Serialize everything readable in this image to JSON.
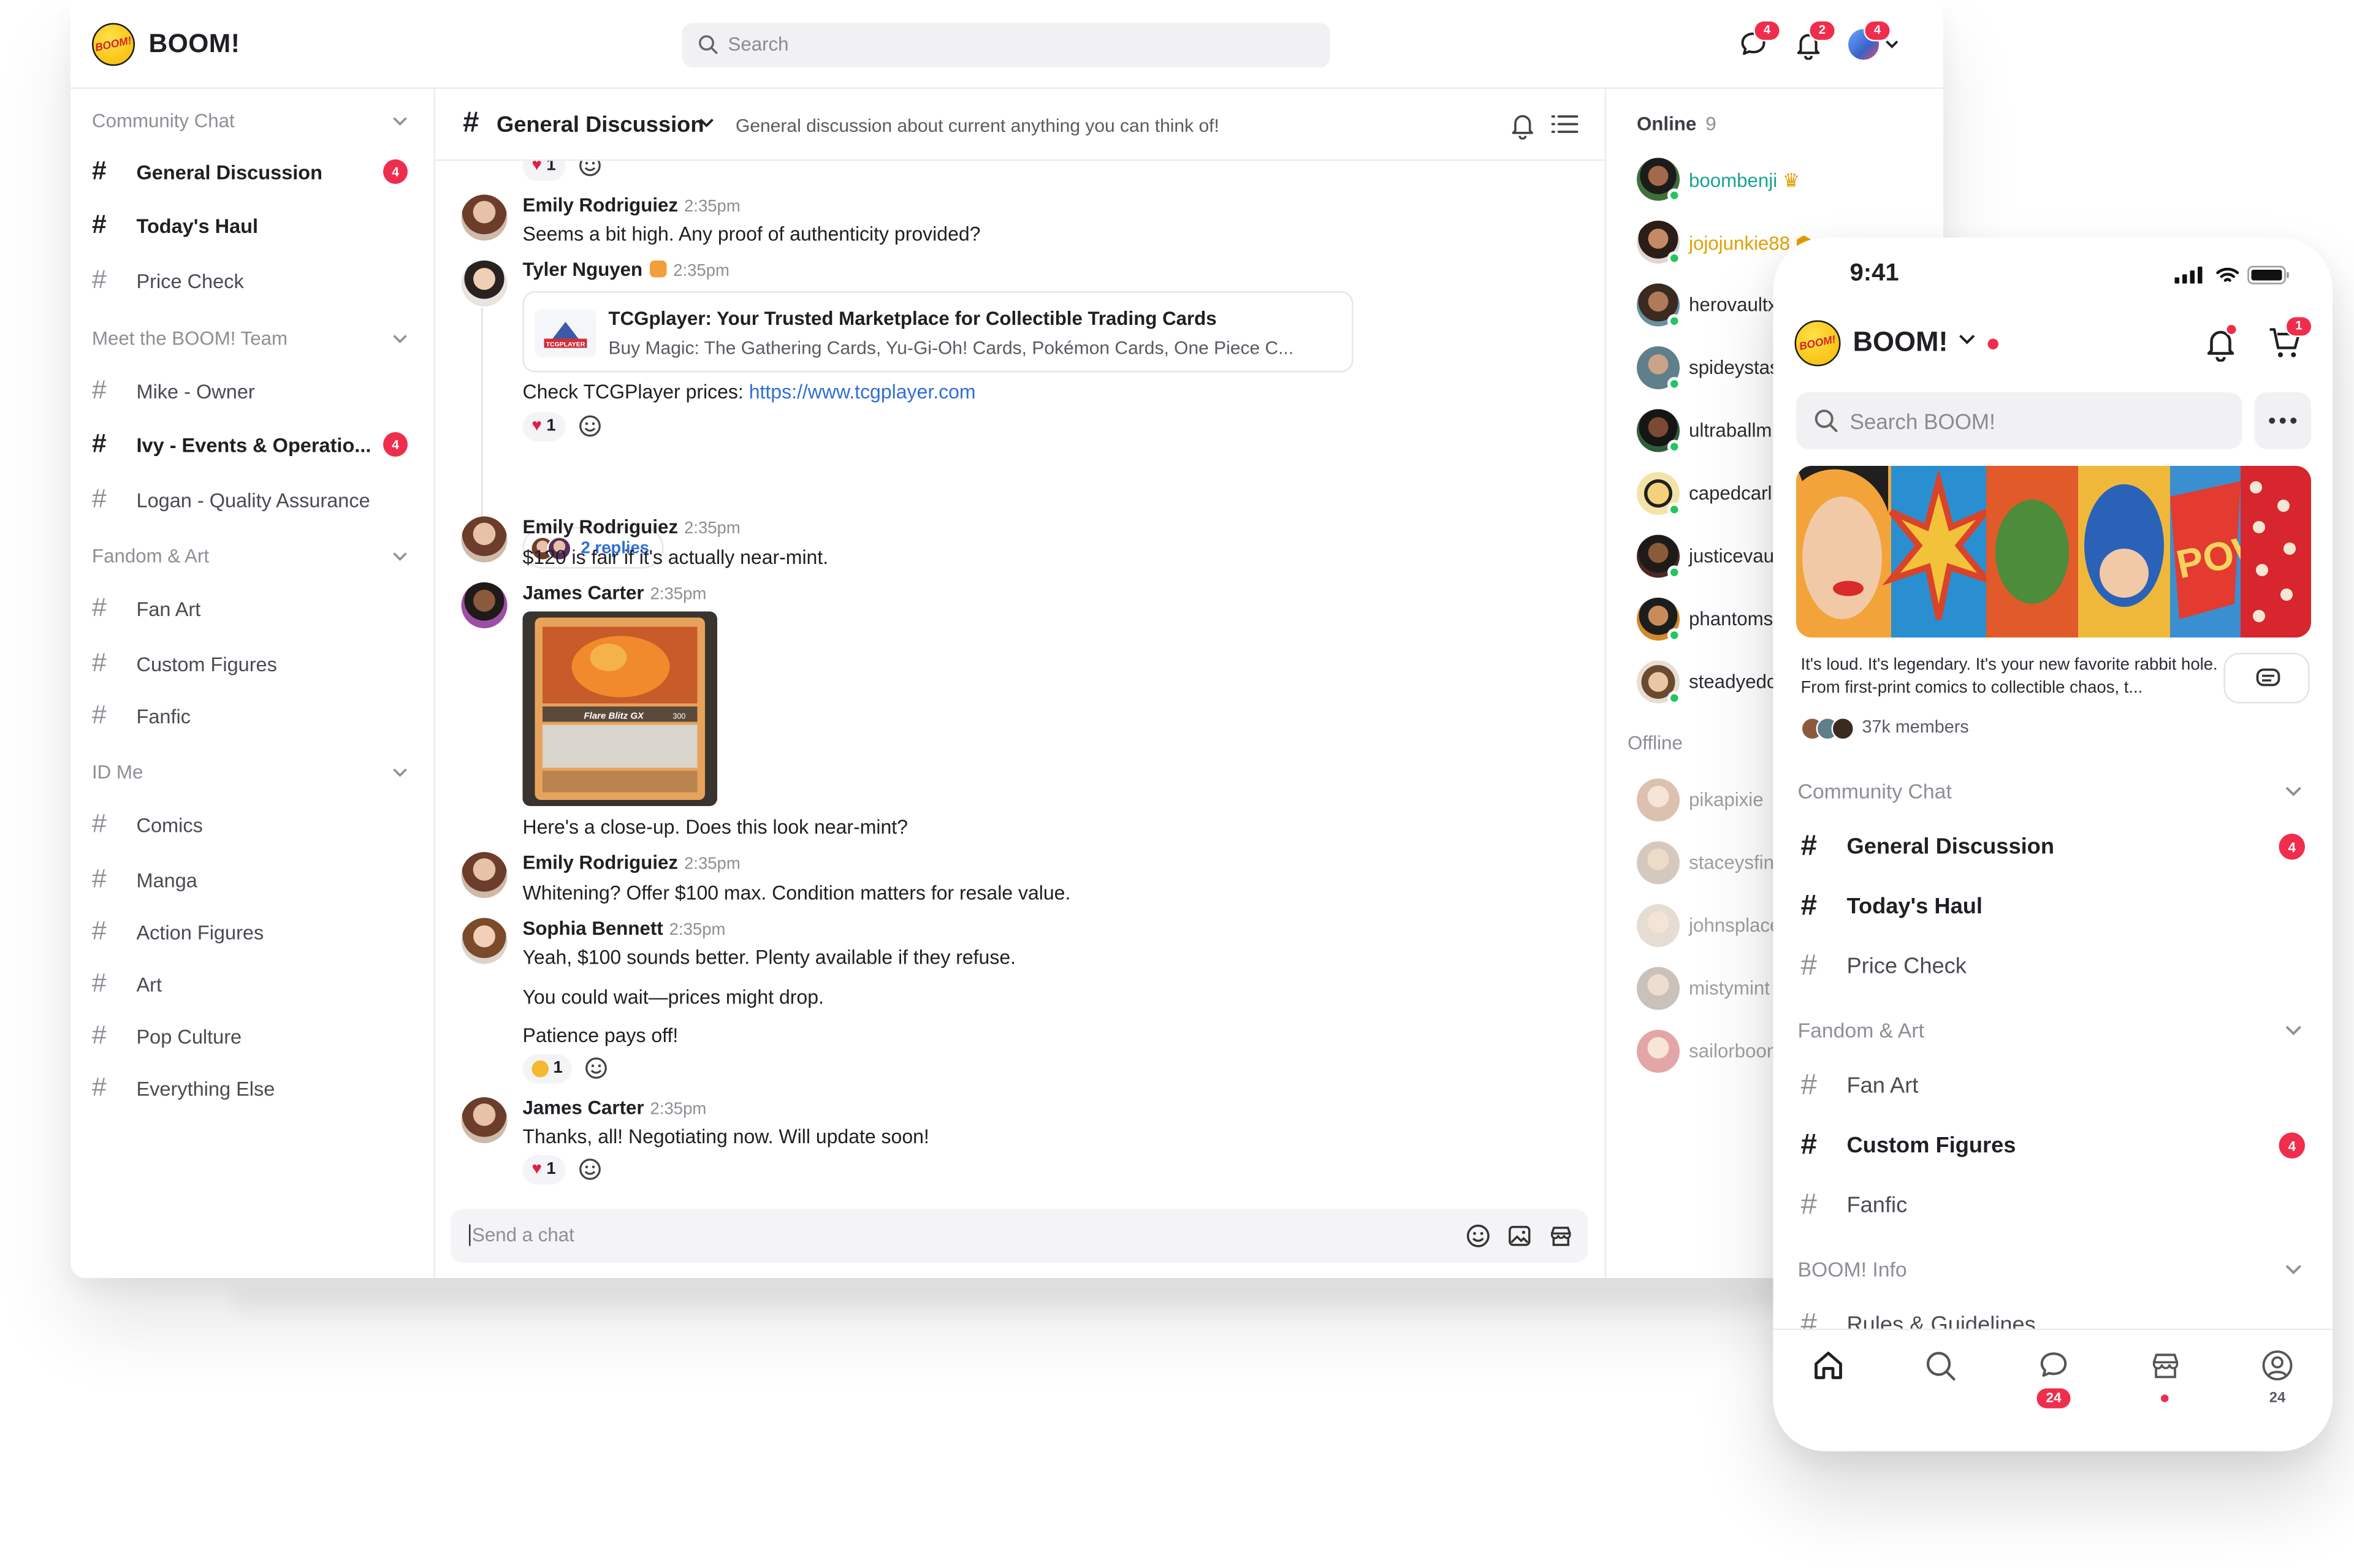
{
  "app": {
    "brand": "BOOM!",
    "logo_text": "BOOM!"
  },
  "topbar": {
    "search_placeholder": "Search",
    "chat_badge": "4",
    "notif_badge": "2",
    "avatar_badge": "4"
  },
  "sidebar": {
    "sections": [
      {
        "title": "Community Chat",
        "channels": [
          {
            "label": "General Discussion",
            "bold": true,
            "count": "4"
          },
          {
            "label": "Today's Haul",
            "bold": true,
            "count": ""
          },
          {
            "label": "Price Check",
            "bold": false,
            "count": ""
          }
        ]
      },
      {
        "title": "Meet the BOOM! Team",
        "channels": [
          {
            "label": "Mike - Owner",
            "bold": false,
            "count": ""
          },
          {
            "label": "Ivy - Events & Operatio...",
            "bold": true,
            "count": "4"
          },
          {
            "label": "Logan - Quality Assurance",
            "bold": false,
            "count": ""
          }
        ]
      },
      {
        "title": "Fandom & Art",
        "channels": [
          {
            "label": "Fan Art",
            "bold": false,
            "count": ""
          },
          {
            "label": "Custom Figures",
            "bold": false,
            "count": ""
          },
          {
            "label": "Fanfic",
            "bold": false,
            "count": ""
          }
        ]
      },
      {
        "title": "ID Me",
        "channels": [
          {
            "label": "Comics",
            "bold": false,
            "count": ""
          },
          {
            "label": "Manga",
            "bold": false,
            "count": ""
          },
          {
            "label": "Action Figures",
            "bold": false,
            "count": ""
          },
          {
            "label": "Art",
            "bold": false,
            "count": ""
          },
          {
            "label": "Pop Culture",
            "bold": false,
            "count": ""
          },
          {
            "label": "Everything Else",
            "bold": false,
            "count": ""
          }
        ]
      }
    ]
  },
  "chat": {
    "channel_title": "General Discussion",
    "channel_desc": "General discussion about current anything you can think of!",
    "top_reaction": "1",
    "messages": [
      {
        "name": "Emily Rodriguiez",
        "time": "2:35pm",
        "text": "Seems a bit high. Any proof of authenticity provided?"
      },
      {
        "name": "Tyler Nguyen",
        "time": "2:35pm",
        "link_title": "TCGplayer: Your Trusted Marketplace for Collectible Trading Cards",
        "link_desc": "Buy Magic: The Gathering Cards, Yu-Gi-Oh! Cards, Pokémon Cards, One Piece C...",
        "link_thumb": "TCGPLAYER",
        "text": "Check TCGPlayer prices: ",
        "url": "https://www.tcgplayer.com",
        "reaction": "1",
        "replies": "2 replies"
      },
      {
        "name": "Emily Rodriguiez",
        "time": "2:35pm",
        "text": "$120 is fair if it's actually near-mint."
      },
      {
        "name": "James Carter",
        "time": "2:35pm",
        "card_line": "Flare Blitz GX",
        "card_hp": "300",
        "text": "Here's a close-up. Does this look near-mint?"
      },
      {
        "name": "Emily Rodriguiez",
        "time": "2:35pm",
        "text": "Whitening? Offer $100 max. Condition matters for resale value."
      },
      {
        "name": "Sophia Bennett",
        "time": "2:35pm",
        "text": "Yeah, $100 sounds better. Plenty available if they refuse.",
        "text2": "You could wait—prices might drop.",
        "text3": "Patience pays off!",
        "reaction": "1"
      },
      {
        "name": "James Carter",
        "time": "2:35pm",
        "text": "Thanks, all! Negotiating now. Will update soon!",
        "reaction": "1"
      }
    ],
    "composer_placeholder": "Send a chat"
  },
  "members": {
    "online_label": "Online",
    "online_count": "9",
    "offline_label": "Offline",
    "online": [
      {
        "name": "boombenji",
        "color": "#16a394"
      },
      {
        "name": "jojojunkie88",
        "color": "#e0a000"
      },
      {
        "name": "herovaultx",
        "color": "#2b2b33"
      },
      {
        "name": "spideystas",
        "color": "#2b2b33"
      },
      {
        "name": "ultraballmi",
        "color": "#2b2b33"
      },
      {
        "name": "capedcarl",
        "color": "#2b2b33"
      },
      {
        "name": "justicevau",
        "color": "#2b2b33"
      },
      {
        "name": "phantoms",
        "color": "#2b2b33"
      },
      {
        "name": "steadyedc",
        "color": "#2b2b33"
      }
    ],
    "offline": [
      {
        "name": "pikapixie"
      },
      {
        "name": "staceysfin"
      },
      {
        "name": "johnsplace"
      },
      {
        "name": "mistymint"
      },
      {
        "name": "sailorboon"
      }
    ]
  },
  "phone": {
    "time": "9:41",
    "brand": "BOOM!",
    "cart_badge": "1",
    "search_placeholder": "Search BOOM!",
    "banner_word": "POW",
    "desc": "It's loud. It's legendary. It's your new favorite rabbit hole. From first-print comics to collectible chaos, t...",
    "members": "37k members",
    "sections": [
      {
        "title": "Community Chat",
        "channels": [
          {
            "label": "General Discussion",
            "bold": true,
            "count": "4"
          },
          {
            "label": "Today's Haul",
            "bold": true,
            "count": ""
          },
          {
            "label": "Price Check",
            "bold": false,
            "count": ""
          }
        ]
      },
      {
        "title": "Fandom & Art",
        "channels": [
          {
            "label": "Fan Art",
            "bold": false,
            "count": ""
          },
          {
            "label": "Custom Figures",
            "bold": true,
            "count": "4"
          },
          {
            "label": "Fanfic",
            "bold": false,
            "count": ""
          }
        ]
      },
      {
        "title": "BOOM! Info",
        "channels": [
          {
            "label": "Rules & Guidelines",
            "bold": false,
            "count": ""
          }
        ]
      }
    ],
    "tabs": {
      "chat_badge": "24",
      "profile_count": "24"
    }
  },
  "colors": {
    "accent": "#f02d4d",
    "link": "#2f6fd6",
    "online": "#22c55e"
  }
}
